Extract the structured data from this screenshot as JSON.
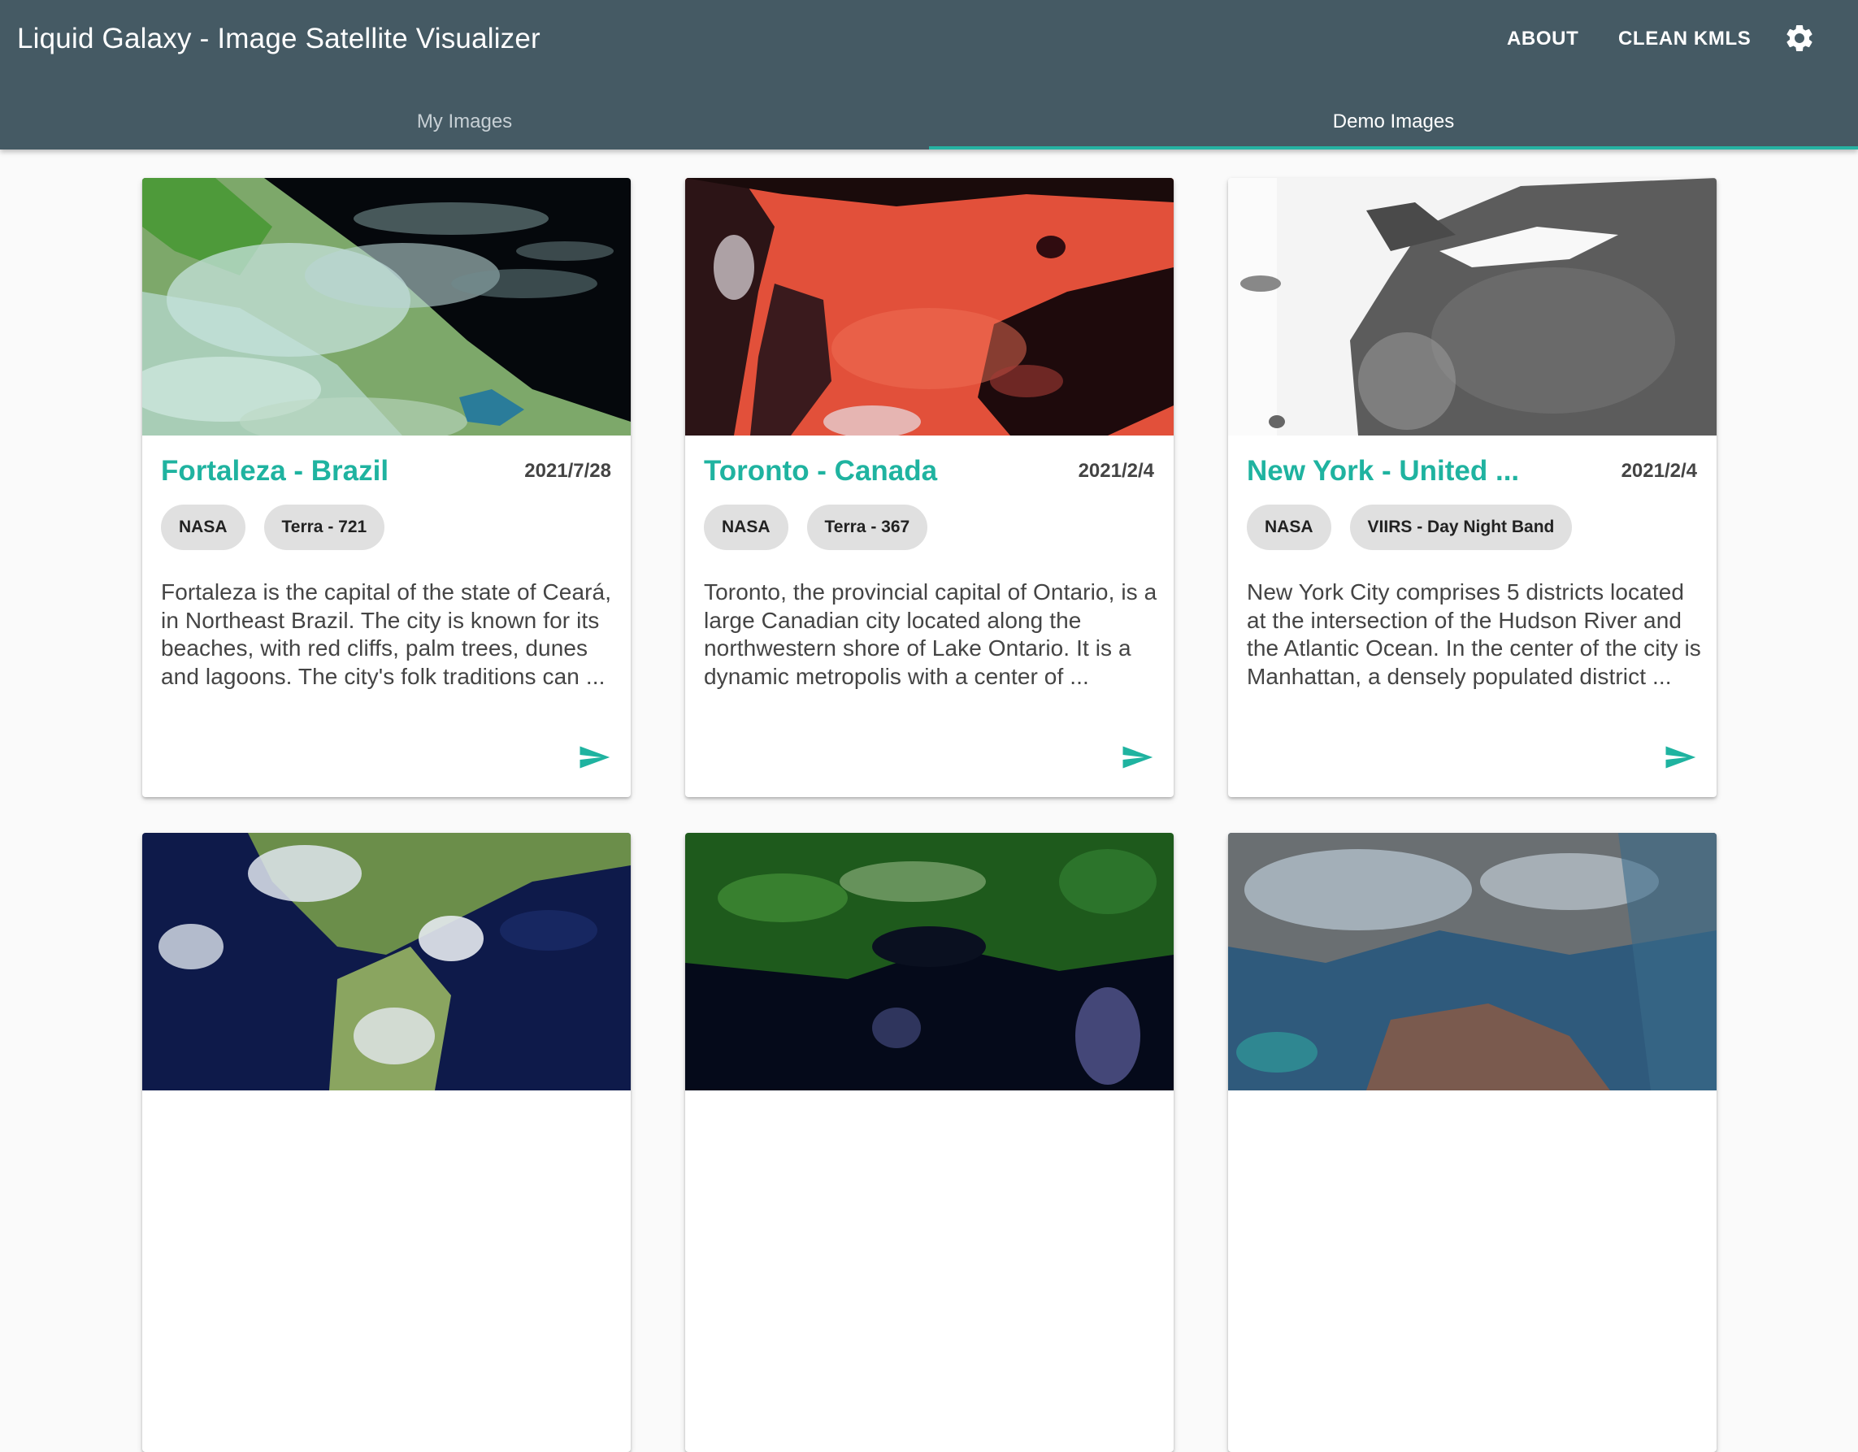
{
  "app": {
    "title": "Liquid Galaxy - Image Satellite Visualizer",
    "actions": {
      "about": "ABOUT",
      "clean": "CLEAN KMLS"
    },
    "settings_icon": "gear-icon"
  },
  "tabs": [
    {
      "label": "My Images",
      "selected": false
    },
    {
      "label": "Demo Images",
      "selected": true
    }
  ],
  "colors": {
    "appbar": "#455a64",
    "accent": "#1fb3a0",
    "chip": "#e0e0e0"
  },
  "cards": [
    {
      "title": "Fortaleza - Brazil",
      "date": "2021/7/28",
      "chips": [
        "NASA",
        "Terra - 721"
      ],
      "description": "Fortaleza is the capital of the state of Ceará, in Northeast Brazil. The city is known for its beaches, with red cliffs, palm trees, dunes and lagoons. The city's folk traditions can ...",
      "send_icon": "send-icon"
    },
    {
      "title": "Toronto - Canada",
      "date": "2021/2/4",
      "chips": [
        "NASA",
        "Terra - 367"
      ],
      "description": "Toronto, the provincial capital of Ontario, is a large Canadian city located along the northwestern shore of Lake Ontario. It is a dynamic metropolis with a center of ...",
      "send_icon": "send-icon"
    },
    {
      "title": "New York - United ...",
      "date": "2021/2/4",
      "chips": [
        "NASA",
        "VIIRS - Day Night Band"
      ],
      "description": "New York City comprises 5 districts located at the intersection of the Hudson River and the Atlantic Ocean. In the center of the city is Manhattan, a densely populated district ...",
      "send_icon": "send-icon"
    },
    {
      "title": "",
      "date": "",
      "chips": [],
      "description": ""
    },
    {
      "title": "",
      "date": "",
      "chips": [],
      "description": ""
    },
    {
      "title": "",
      "date": "",
      "chips": [],
      "description": ""
    }
  ]
}
